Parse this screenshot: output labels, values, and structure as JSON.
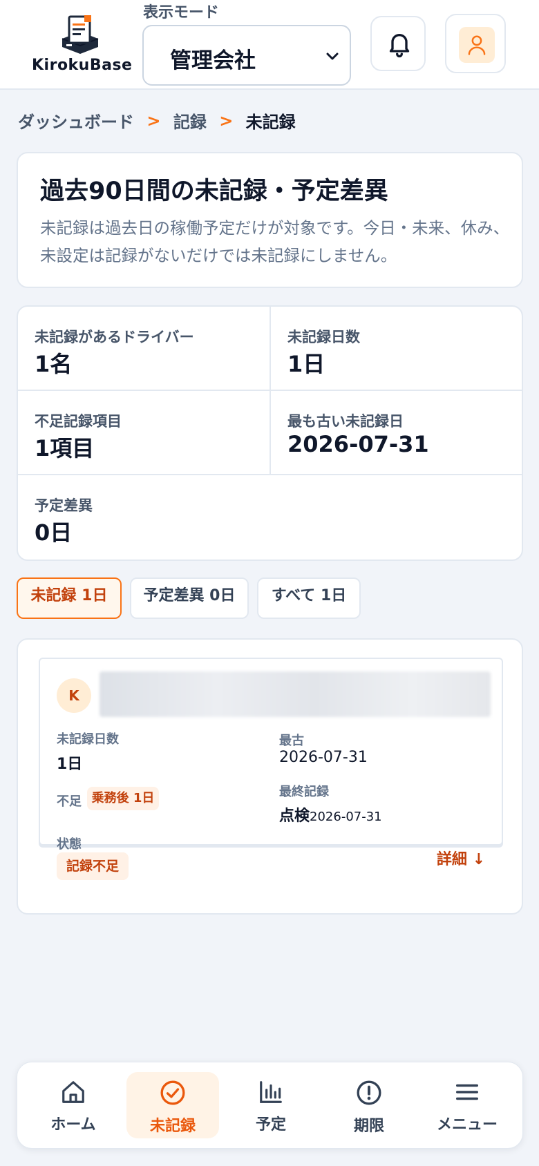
{
  "app": {
    "logo_text": "KirokuBase",
    "mode_label": "表示モード",
    "mode_value": "管理会社"
  },
  "breadcrumb": {
    "items": [
      "ダッシュボード",
      "記録",
      "未記録"
    ],
    "separator": ">"
  },
  "intro": {
    "title": "過去90日間の未記録・予定差異",
    "description": "未記録は過去日の稼働予定だけが対象です。今日・未来、休み、未設定は記録がないだけでは未記録にしません。"
  },
  "stats": [
    {
      "label": "未記録があるドライバー",
      "value": "1名"
    },
    {
      "label": "未記録日数",
      "value": "1日"
    },
    {
      "label": "不足記録項目",
      "value": "1項目"
    },
    {
      "label": "最も古い未記録日",
      "value": "2026-07-31"
    },
    {
      "label": "予定差異",
      "value": "0日"
    }
  ],
  "filters": [
    {
      "label": "未記録 1日",
      "active": true
    },
    {
      "label": "予定差異 0日",
      "active": false
    },
    {
      "label": "すべて 1日",
      "active": false
    }
  ],
  "driver": {
    "initial": "K",
    "missing_days_label": "未記録日数",
    "missing_days_value": "1日",
    "oldest_label": "最古",
    "oldest_value": "2026-07-31",
    "lack_label": "不足",
    "lack_tag": "乗務後 1日",
    "last_record_label": "最終記録",
    "last_record_type": "点検",
    "last_record_date": "2026-07-31",
    "status_label": "状態",
    "status_value": "記録不足",
    "detail_link": "詳細 ↓"
  },
  "bottom_nav": [
    {
      "label": "ホーム",
      "icon": "home-icon",
      "active": false
    },
    {
      "label": "未記録",
      "icon": "check-circle-icon",
      "active": true
    },
    {
      "label": "予定",
      "icon": "bar-chart-icon",
      "active": false
    },
    {
      "label": "期限",
      "icon": "alert-circle-icon",
      "active": false
    },
    {
      "label": "メニュー",
      "icon": "menu-icon",
      "active": false
    }
  ],
  "colors": {
    "accent": "#f97316",
    "accent_dark": "#c2410c",
    "background": "#f1f4f9",
    "text": "#0f172a"
  }
}
